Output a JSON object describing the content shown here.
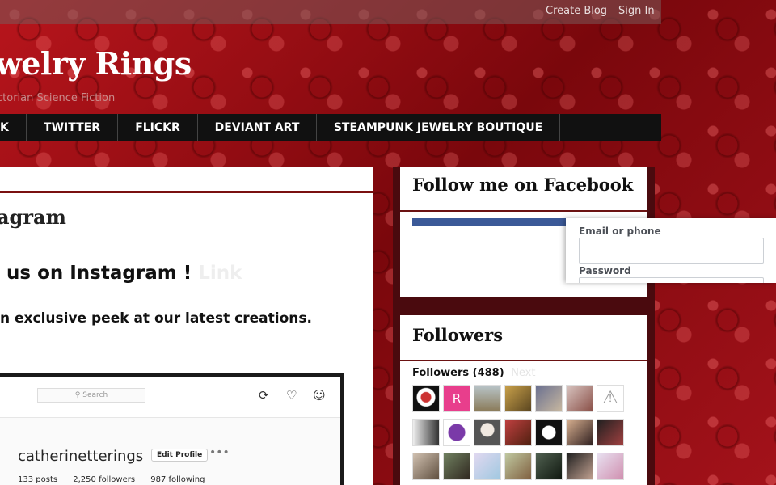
{
  "topbar": {
    "create_blog": "Create Blog",
    "sign_in": "Sign In"
  },
  "blog": {
    "title": "welry Rings",
    "description": "ctorian Science Fiction"
  },
  "nav": {
    "items": [
      "K",
      "TWITTER",
      "FLICKR",
      "DEVIANT ART",
      "STEAMPUNK JEWELRY BOUTIQUE"
    ]
  },
  "post": {
    "title": "agram",
    "line1": "us on Instagram !",
    "line1_link": "Link",
    "line2": "n exclusive peek at our latest creations."
  },
  "instagram": {
    "search_placeholder": "Search",
    "username": "catherinetterings",
    "edit_profile": "Edit Profile",
    "posts": "133 posts",
    "followers": "2,250 followers",
    "following": "987 following"
  },
  "facebook_widget": {
    "title": "Follow me on Facebook",
    "email_label": "Email or phone",
    "password_label": "Password"
  },
  "followers_widget": {
    "title": "Followers",
    "count_label": "Followers (488)",
    "next_label": "Next"
  },
  "colors": {
    "brand_red": "#8e0b10",
    "nav_bg": "#111111",
    "facebook_blue": "#3b5998"
  },
  "icons": [
    "search-icon",
    "compass-icon",
    "heart-icon",
    "user-icon",
    "more-icon",
    "warning-icon"
  ]
}
